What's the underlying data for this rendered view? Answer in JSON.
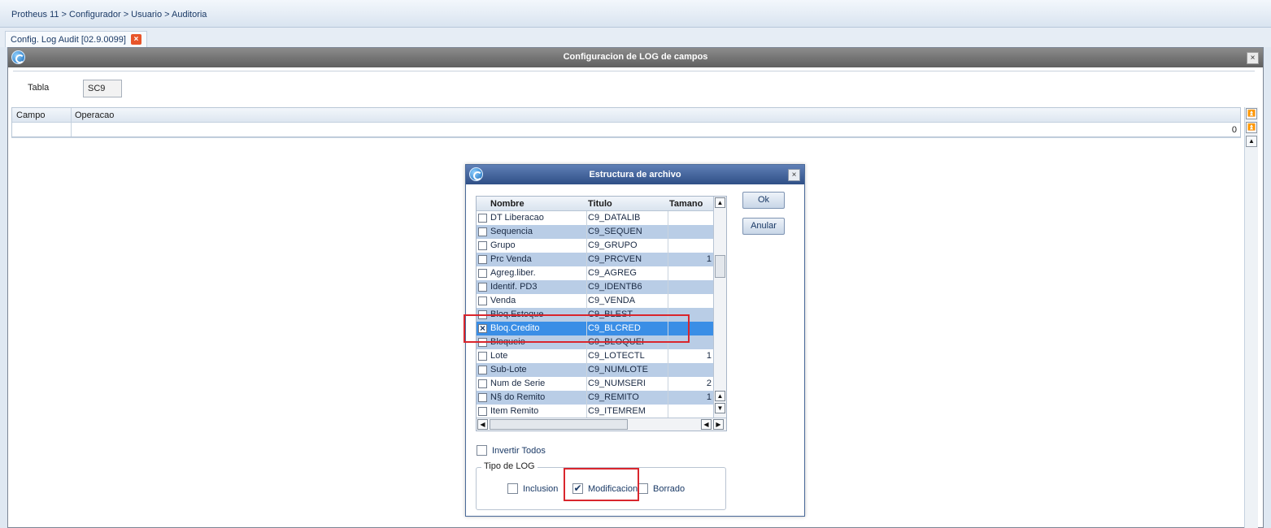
{
  "breadcrumb": "Protheus 11 > Configurador > Usuario > Auditoria",
  "tab": {
    "label": "Config. Log Audit [02.9.0099]",
    "close": "×"
  },
  "main_window": {
    "title": "Configuracion de LOG de campos",
    "close": "×",
    "tabla_label": "Tabla",
    "tabla_value": "SC9",
    "grid": {
      "headers": [
        "Campo",
        "Operacao"
      ],
      "row_value": "0"
    }
  },
  "dialog": {
    "title": "Estructura de archivo",
    "close": "×",
    "columns": [
      "Nombre",
      "Titulo",
      "Tamano"
    ],
    "rows": [
      {
        "nombre": "DT Liberacao",
        "titulo": "C9_DATALIB",
        "tamano": "",
        "checked": false
      },
      {
        "nombre": "Sequencia",
        "titulo": "C9_SEQUEN",
        "tamano": "",
        "checked": false
      },
      {
        "nombre": "Grupo",
        "titulo": "C9_GRUPO",
        "tamano": "",
        "checked": false
      },
      {
        "nombre": "Prc Venda",
        "titulo": "C9_PRCVEN",
        "tamano": "1",
        "checked": false
      },
      {
        "nombre": "Agreg.liber.",
        "titulo": "C9_AGREG",
        "tamano": "",
        "checked": false
      },
      {
        "nombre": "Identif. PD3",
        "titulo": "C9_IDENTB6",
        "tamano": "",
        "checked": false
      },
      {
        "nombre": "Venda",
        "titulo": "C9_VENDA",
        "tamano": "",
        "checked": false
      },
      {
        "nombre": "Bloq.Estoque",
        "titulo": "C9_BLEST",
        "tamano": "",
        "checked": false
      },
      {
        "nombre": "Bloq.Credito",
        "titulo": "C9_BLCRED",
        "tamano": "",
        "checked": true
      },
      {
        "nombre": "Bloqueio",
        "titulo": "C9_BLOQUEI",
        "tamano": "",
        "checked": false
      },
      {
        "nombre": "Lote",
        "titulo": "C9_LOTECTL",
        "tamano": "1",
        "checked": false
      },
      {
        "nombre": "Sub-Lote",
        "titulo": "C9_NUMLOTE",
        "tamano": "",
        "checked": false
      },
      {
        "nombre": "Num de Serie",
        "titulo": "C9_NUMSERI",
        "tamano": "2",
        "checked": false
      },
      {
        "nombre": "N§ do Remito",
        "titulo": "C9_REMITO",
        "tamano": "1",
        "checked": false
      },
      {
        "nombre": "Item Remito",
        "titulo": "C9_ITEMREM",
        "tamano": "",
        "checked": false
      }
    ],
    "ok_label": "Ok",
    "anular_label": "Anular",
    "invertir_label": "Invertir Todos",
    "tipo_log": {
      "legend": "Tipo de LOG",
      "inclusion": "Inclusion",
      "modificacion": "Modificacion",
      "borrado": "Borrado",
      "check_mark": "✔"
    }
  },
  "colors": {
    "highlight": "#d9262d",
    "selected_row": "#3a8ee6",
    "alt_row": "#b9cde6"
  }
}
